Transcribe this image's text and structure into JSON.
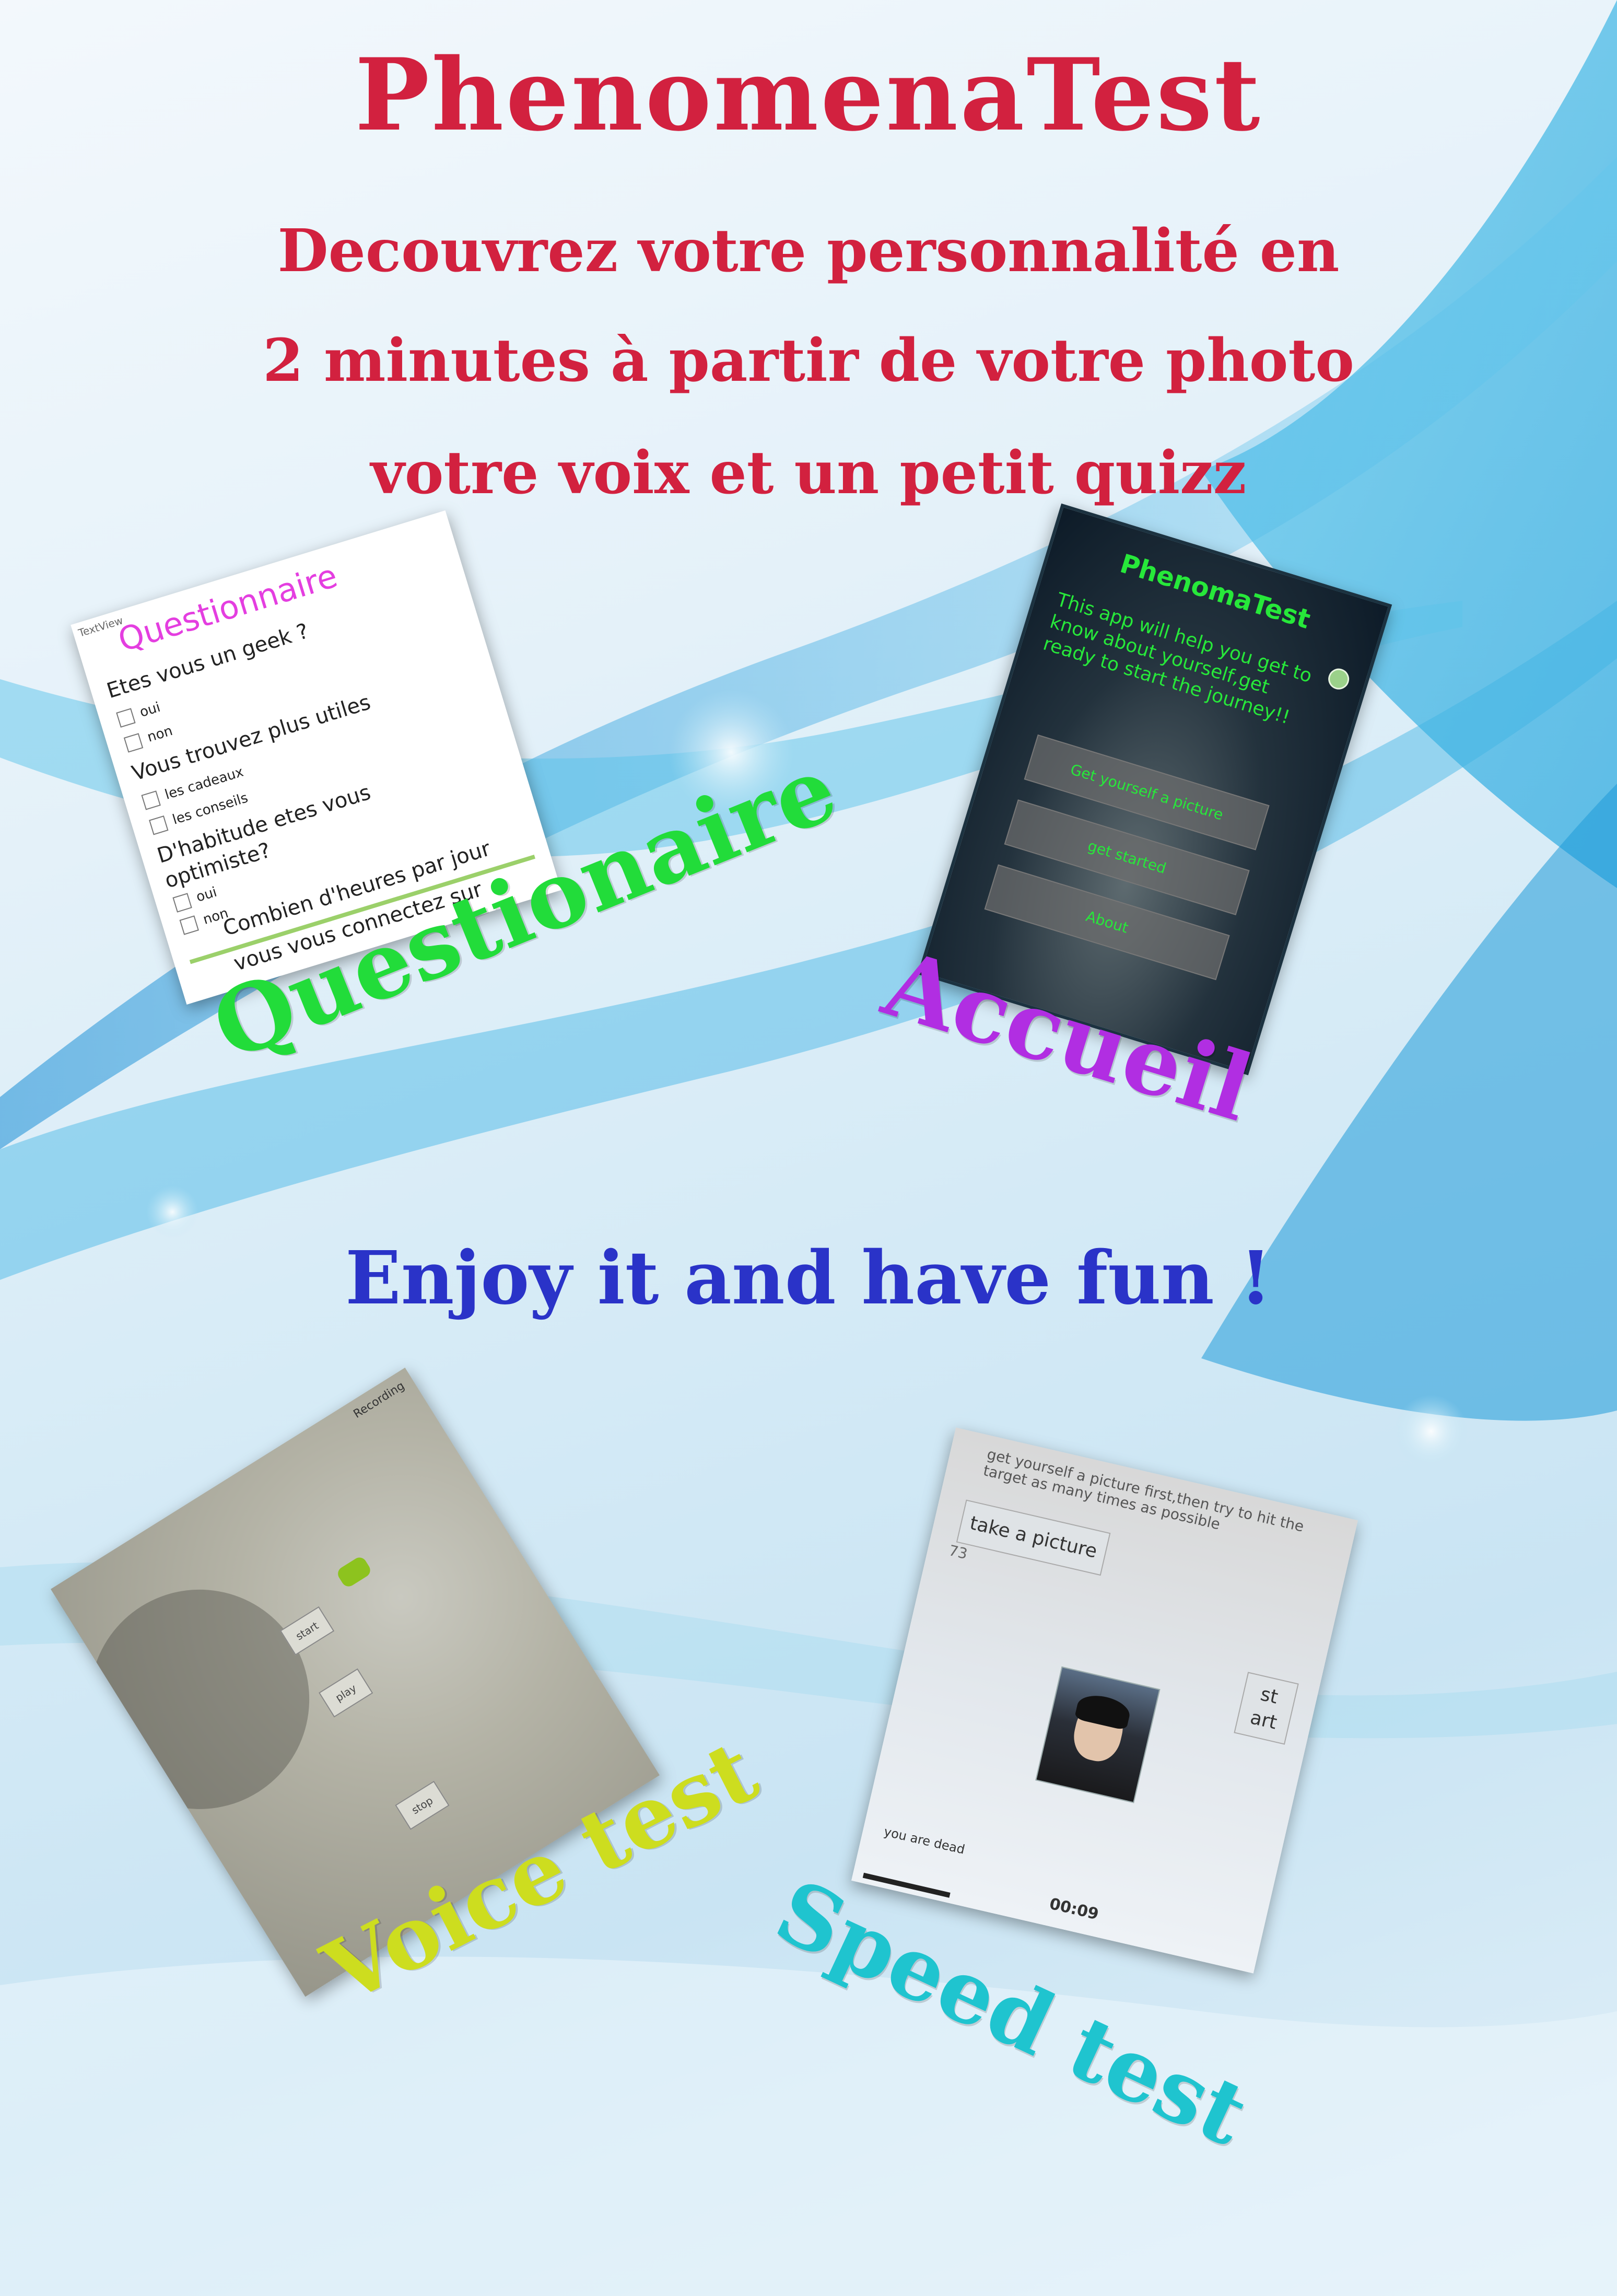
{
  "poster": {
    "title": "PhenomenaTest",
    "subtitle_line1": "Decouvrez votre personnalité en",
    "subtitle_line2": "2 minutes à partir de votre photo",
    "subtitle_line3": "votre voix et un petit quizz",
    "tagline": "Enjoy it and have fun !"
  },
  "labels": {
    "questionaire": "Questionaire",
    "accueil": "Accueil",
    "voice_test": "Voice test",
    "speed_test": "Speed test"
  },
  "questionnaire_screen": {
    "textview": "TextView",
    "title": "Questionnaire",
    "q1": "Etes vous un geek ?",
    "q1_opt1": "oui",
    "q1_opt2": "non",
    "q2": "Vous trouvez plus utiles",
    "q2_opt1": "les cadeaux",
    "q2_opt2": "les conseils",
    "q3_line1": "D'habitude etes vous",
    "q3_line2": "optimiste?",
    "q3_opt1": "oui",
    "q3_opt2": "non",
    "q4_line1": "Combien d'heures par jour",
    "q4_line2": "vous vous connectez sur"
  },
  "accueil_screen": {
    "app_title": "PhenomaTest",
    "intro": "This app will help you get to know about yourself,get ready to start the journey!!",
    "buttons": [
      "Get yourself a picture",
      "get started",
      "About"
    ]
  },
  "voice_screen": {
    "recording": "Recording",
    "start": "start",
    "play": "play",
    "stop": "stop"
  },
  "speed_screen": {
    "instructions": "get yourself a picture first,then try to hit the target as many times as possible",
    "take_picture": "take a picture",
    "count": "73",
    "start_line1": "st",
    "start_line2": "art",
    "status": "you are dead",
    "timer": "00:09"
  }
}
